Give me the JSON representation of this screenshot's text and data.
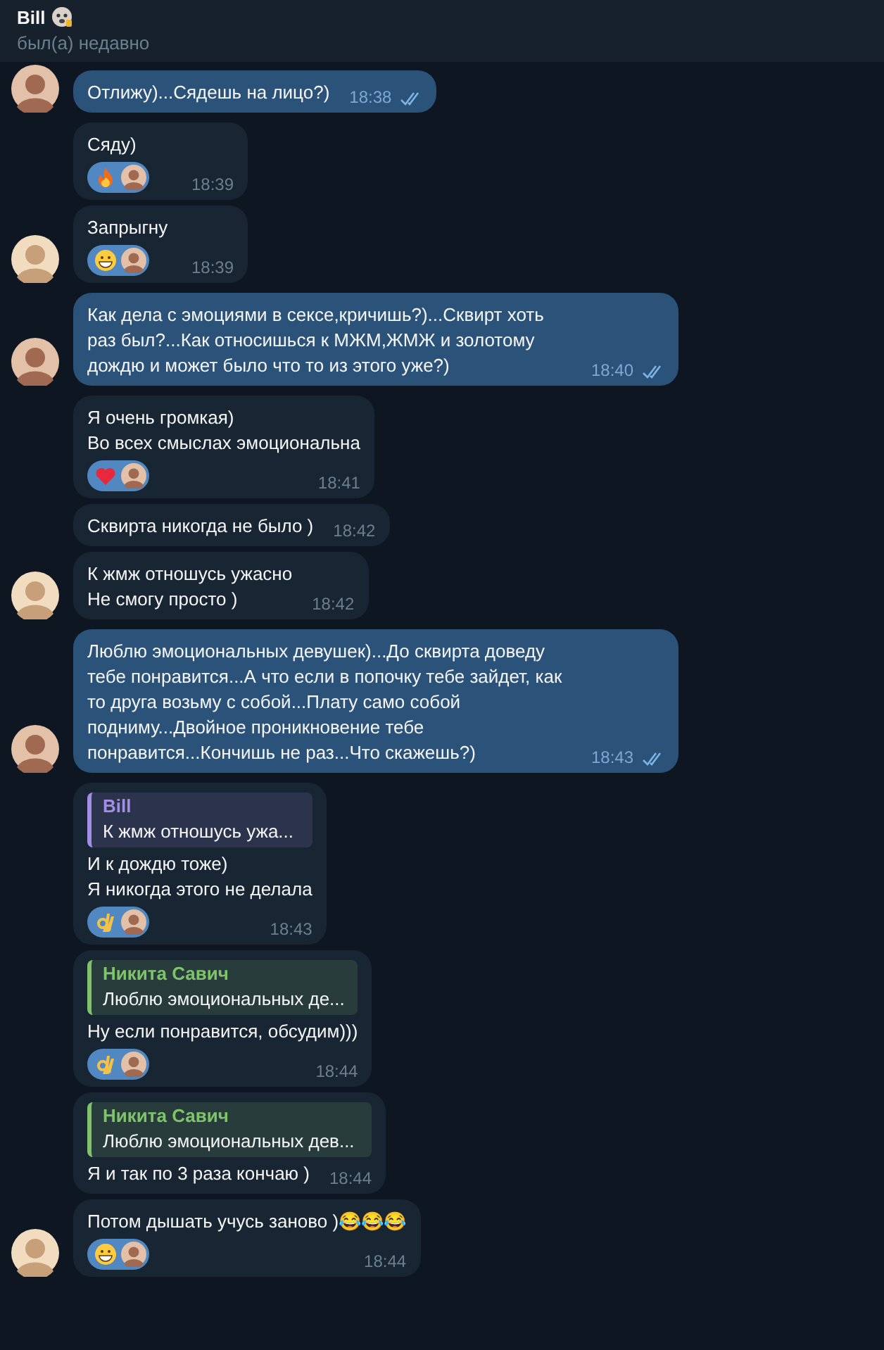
{
  "header": {
    "title": "Bill",
    "status": "был(а) недавно"
  },
  "groups": [
    {
      "outgoing": true,
      "messages": [
        {
          "text": "Отлижу)...Сядешь на лицо?)",
          "time": "18:38",
          "read": true
        }
      ]
    },
    {
      "outgoing": false,
      "messages": [
        {
          "text": "Сяду)",
          "time": "18:39",
          "reactions": [
            {
              "kind": "fire"
            }
          ]
        },
        {
          "text": "Запрыгну",
          "time": "18:39",
          "reactions": [
            {
              "kind": "grin"
            }
          ]
        }
      ]
    },
    {
      "outgoing": true,
      "messages": [
        {
          "text": "Как дела с эмоциями в сексе,кричишь?)...Сквирт хоть раз был?...Как относишься к МЖМ,ЖМЖ и золотому дождю и может было что то из этого уже?)",
          "time": "18:40",
          "read": true
        }
      ]
    },
    {
      "outgoing": false,
      "messages": [
        {
          "text": "Я очень громкая)\nВо всех смыслах эмоциональна",
          "time": "18:41",
          "reactions": [
            {
              "kind": "heart"
            }
          ]
        },
        {
          "text": "Сквирта никогда не было )",
          "time": "18:42"
        },
        {
          "text": "К жмж отношусь ужасно\nНе смогу просто )",
          "time": "18:42"
        }
      ]
    },
    {
      "outgoing": true,
      "messages": [
        {
          "text": "Люблю эмоциональных девушек)...До сквирта доведу тебе понравится...А что если в попочку тебе зайдет, как то друга возьму с собой...Плату само собой подниму...Двойное проникновение тебе понравится...Кончишь не раз...Что скажешь?)",
          "time": "18:43",
          "read": true
        }
      ]
    },
    {
      "outgoing": false,
      "messages": [
        {
          "reply": {
            "name": "Bill",
            "text": "К жмж отношусь ужа...",
            "color": "#a38ee6"
          },
          "text": "И к дождю тоже)\nЯ никогда этого не делала",
          "time": "18:43",
          "reactions": [
            {
              "kind": "ok"
            }
          ]
        },
        {
          "reply": {
            "name": "Никита Савич",
            "text": "Люблю эмоциональных де...",
            "color": "#7fc46a"
          },
          "text": "Ну если понравится, обсудим)))",
          "time": "18:44",
          "reactions": [
            {
              "kind": "ok"
            }
          ]
        },
        {
          "reply": {
            "name": "Никита Савич",
            "text": "Люблю эмоциональных дев...",
            "color": "#7fc46a"
          },
          "text": "Я и так по 3 раза кончаю )",
          "time": "18:44"
        },
        {
          "text": "Потом дышать учусь заново )😂😂😂",
          "time": "18:44",
          "reactions": [
            {
              "kind": "grin"
            }
          ]
        }
      ]
    }
  ]
}
